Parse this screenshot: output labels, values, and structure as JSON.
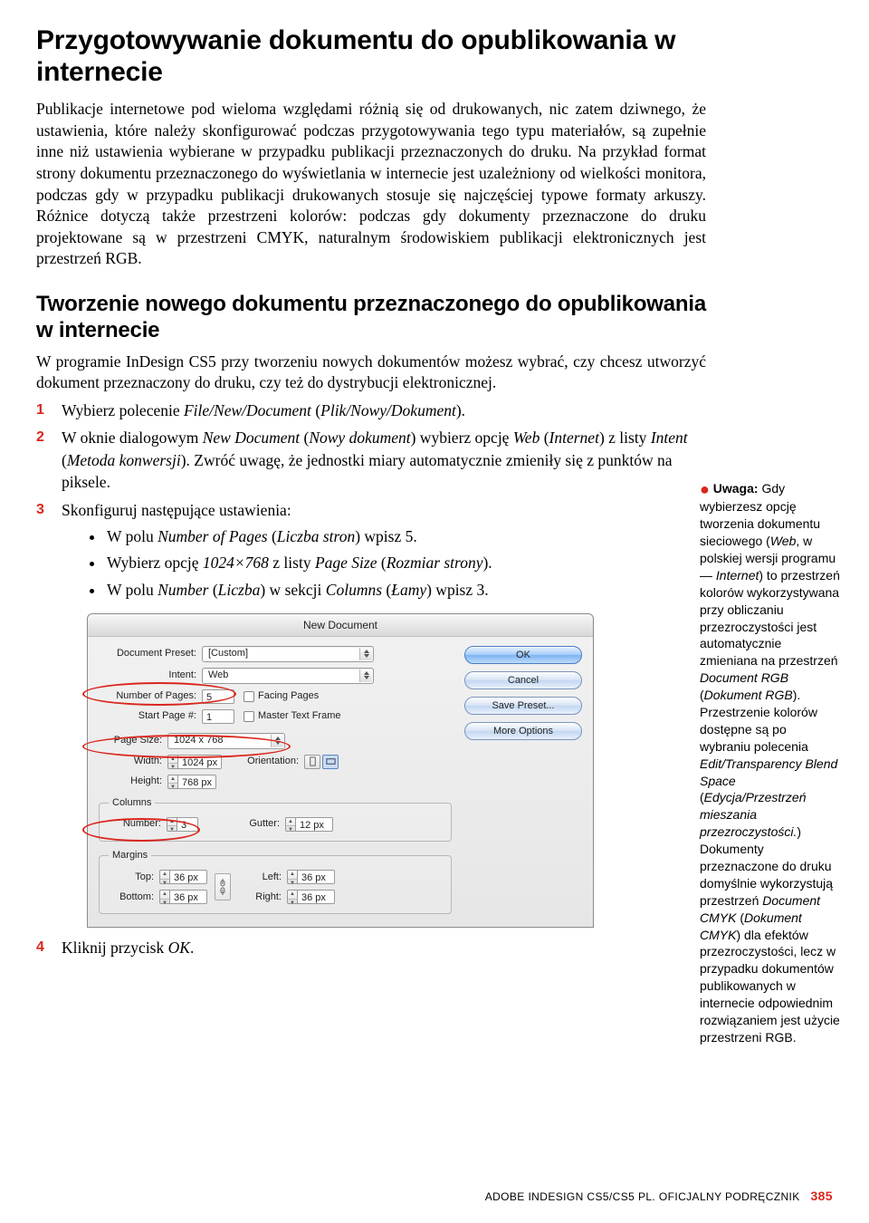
{
  "h1": "Przygotowywanie dokumentu do opublikowania w internecie",
  "intro": "Publikacje internetowe pod wieloma względami różnią się od drukowanych, nic zatem dziwnego, że ustawienia, które należy skonfigurować podczas przygotowywania tego typu materiałów, są zupełnie inne niż ustawienia wybierane w przypadku publikacji przeznaczonych do druku. Na przykład format strony dokumentu przeznaczonego do wyświetlania w internecie jest uzależniony od wielkości monitora, podczas gdy w przypadku publikacji drukowanych stosuje się najczęściej typowe formaty arkuszy. Różnice dotyczą także przestrzeni kolorów: podczas gdy dokumenty przeznaczone do druku projektowane są w przestrzeni CMYK, naturalnym środowiskiem publikacji elektronicznych jest przestrzeń RGB.",
  "h2": "Tworzenie nowego dokumentu przeznaczonego do opublikowania w internecie",
  "para2": "W programie InDesign CS5 przy tworzeniu nowych dokumentów możesz wybrać, czy chcesz utworzyć dokument przeznaczony do druku, czy też do dystrybucji elektronicznej.",
  "steps": {
    "s1a": "Wybierz polecenie ",
    "s1b": "File/New/Document",
    "s1c": " (",
    "s1d": "Plik/Nowy/Dokument",
    "s1e": ").",
    "s2a": "W oknie dialogowym ",
    "s2b": "New Document",
    "s2c": " (",
    "s2d": "Nowy dokument",
    "s2e": ") wybierz opcję ",
    "s2f": "Web",
    "s2g": " (",
    "s2h": "Internet",
    "s2i": ") z listy ",
    "s2j": "Intent",
    "s2k": " (",
    "s2l": "Metoda konwersji",
    "s2m": "). Zwróć uwagę, że jednostki miary automatycznie zmieniły się z punktów na piksele.",
    "s3": "Skonfiguruj następujące ustawienia:",
    "s3b1a": "W polu ",
    "s3b1b": "Number of Pages",
    "s3b1c": " (",
    "s3b1d": "Liczba stron",
    "s3b1e": ") wpisz 5.",
    "s3b2a": "Wybierz opcję ",
    "s3b2b": "1024×768",
    "s3b2c": " z listy ",
    "s3b2d": "Page Size",
    "s3b2e": " (",
    "s3b2f": "Rozmiar strony",
    "s3b2g": ").",
    "s3b3a": "W polu ",
    "s3b3b": "Number",
    "s3b3c": " (",
    "s3b3d": "Liczba",
    "s3b3e": ") w sekcji ",
    "s3b3f": "Columns",
    "s3b3g": " (",
    "s3b3h": "Łamy",
    "s3b3i": ") wpisz 3.",
    "s4a": "Kliknij przycisk ",
    "s4b": "OK",
    "s4c": "."
  },
  "dialog": {
    "title": "New Document",
    "docpreset_lbl": "Document Preset:",
    "docpreset_val": "[Custom]",
    "intent_lbl": "Intent:",
    "intent_val": "Web",
    "numpages_lbl": "Number of Pages:",
    "numpages_val": "5",
    "facing_lbl": "Facing Pages",
    "startpage_lbl": "Start Page #:",
    "startpage_val": "1",
    "master_lbl": "Master Text Frame",
    "pagesize_lbl": "Page Size:",
    "pagesize_val": "1024 x 768",
    "width_lbl": "Width:",
    "width_val": "1024 px",
    "height_lbl": "Height:",
    "height_val": "768 px",
    "orient_lbl": "Orientation:",
    "columns_legend": "Columns",
    "number_lbl": "Number:",
    "number_val": "3",
    "gutter_lbl": "Gutter:",
    "gutter_val": "12 px",
    "margins_legend": "Margins",
    "top_lbl": "Top:",
    "top_val": "36 px",
    "bottom_lbl": "Bottom:",
    "bottom_val": "36 px",
    "left_lbl": "Left:",
    "left_val": "36 px",
    "right_lbl": "Right:",
    "right_val": "36 px",
    "ok": "OK",
    "cancel": "Cancel",
    "savepreset": "Save Preset...",
    "moreoptions": "More Options"
  },
  "sidebar": {
    "label": "Uwaga:",
    "text_a": " Gdy wybierzesz opcję tworzenia dokumentu sieciowego (",
    "text_b": "Web",
    "text_c": ", w polskiej wersji programu — ",
    "text_d": "Internet",
    "text_e": ") to przestrzeń kolorów wykorzystywana przy obliczaniu przezroczystości jest automatycznie zmieniana na przestrzeń ",
    "text_f": "Document RGB",
    "text_g": " (",
    "text_h": "Dokument RGB",
    "text_i": "). Przestrzenie kolorów dostępne są po wybraniu polecenia ",
    "text_j": "Edit/Transparency Blend Space",
    "text_k": " (",
    "text_l": "Edycja/Przestrzeń mieszania przezroczystości.",
    "text_m": ") Dokumenty przeznaczone do druku domyślnie wykorzystują przestrzeń ",
    "text_n": "Document CMYK",
    "text_o": " (",
    "text_p": "Dokument CMYK",
    "text_q": ") dla efektów przezroczystości, lecz w przypadku dokumentów publikowanych w internecie odpowiednim rozwiązaniem jest użycie przestrzeni RGB."
  },
  "footer": {
    "text": "ADOBE INDESIGN CS5/CS5 PL. OFICJALNY PODRĘCZNIK",
    "page": "385"
  }
}
